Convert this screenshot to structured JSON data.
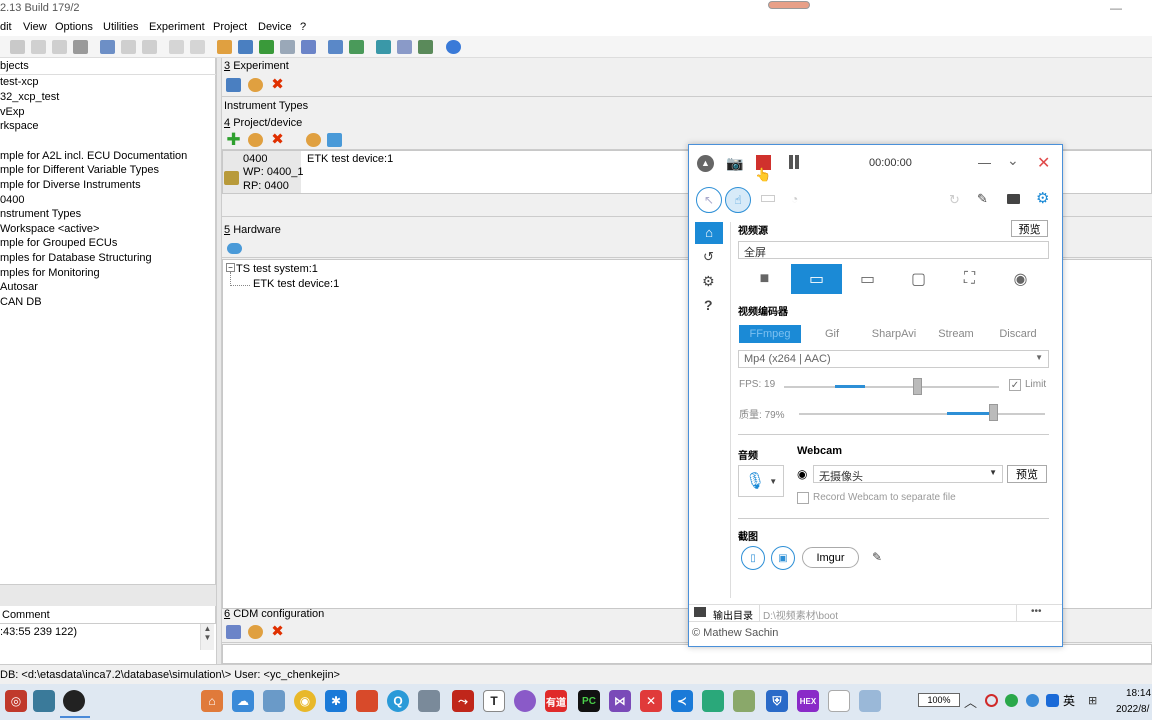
{
  "app": {
    "title": "2.13 Build 179/2",
    "minimize_glyph": "—"
  },
  "menu": [
    "dit",
    "View",
    "Options",
    "Utilities",
    "Experiment",
    "Project",
    "Device",
    "?"
  ],
  "left_panel": {
    "header": "bjects",
    "items": [
      "test-xcp",
      "32_xcp_test",
      "vExp",
      "rkspace",
      "",
      "mple for A2L incl. ECU Documentation",
      "mple for Different Variable Types",
      "mple for Diverse Instruments",
      "0400",
      "nstrument Types",
      "Workspace <active>",
      "mple for Grouped ECUs",
      "mples for Database Structuring",
      "mples for Monitoring",
      "Autosar",
      "CAN DB"
    ],
    "comment_header": "Comment",
    "comment_value": ":43:55 239 122)"
  },
  "sections": {
    "experiment": {
      "num": "3",
      "label": "Experiment",
      "content": "Instrument Types"
    },
    "project": {
      "num": "4",
      "label": "Project/device",
      "code": "0400",
      "wp": "WP: 0400_1",
      "rp": "RP: 0400",
      "device": "ETK test device:1"
    },
    "hardware": {
      "num": "5",
      "label": "Hardware",
      "system": "TS test system:1",
      "device": "ETK test device:1"
    },
    "cdm": {
      "num": "6",
      "label": "CDM configuration"
    }
  },
  "recorder": {
    "timer": "00:00:00",
    "video_source_label": "视频源",
    "preview_label": "预览",
    "source_value": "全屏",
    "encoder_label": "视频编码器",
    "encoders": [
      "FFmpeg",
      "Gif",
      "SharpAvi",
      "Stream",
      "Discard"
    ],
    "active_encoder": "FFmpeg",
    "codec": "Mp4 (x264 | AAC)",
    "fps_label": "FPS:",
    "fps": "19",
    "fps_fraction": 0.62,
    "limit_label": "Limit",
    "quality_label": "质量:",
    "quality": "79%",
    "quality_fraction": 0.79,
    "audio_label": "音频",
    "webcam_label": "Webcam",
    "webcam_value": "无摄像头",
    "webcam_preview": "预览",
    "webcam_separate": "Record Webcam to separate file",
    "screenshot_label": "截图",
    "imgur": "Imgur",
    "output_label": "输出目录",
    "output_path": "D:\\视频素材\\boot",
    "more": "•••",
    "footer": "© Mathew Sachin",
    "accent": "#1b8ad6",
    "record_color": "#d0312d"
  },
  "statusbar": "DB: <d:\\etasdata\\inca7.2\\database\\simulation\\> User: <yc_chenkejin>",
  "taskbar": {
    "time": "18:14",
    "date": "2022/8/",
    "lang": "英",
    "battery": "100%",
    "apps": [
      "home-icon",
      "cloud-icon",
      "network-icon",
      "chrome-icon",
      "app-icon",
      "folder-icon",
      "qq-icon",
      "app2-icon",
      "pdf-icon",
      "text-icon",
      "app3-icon",
      "youdao-icon",
      "pycharm-icon",
      "vs-icon",
      "x-icon",
      "vscode-icon",
      "app4-icon",
      "app5-icon",
      "shield-icon",
      "hex-icon",
      "file-icon",
      "search-icon"
    ],
    "labels": {
      "text": "T",
      "youdao": "有道",
      "pycharm": "PC",
      "hex": "HEX"
    }
  }
}
